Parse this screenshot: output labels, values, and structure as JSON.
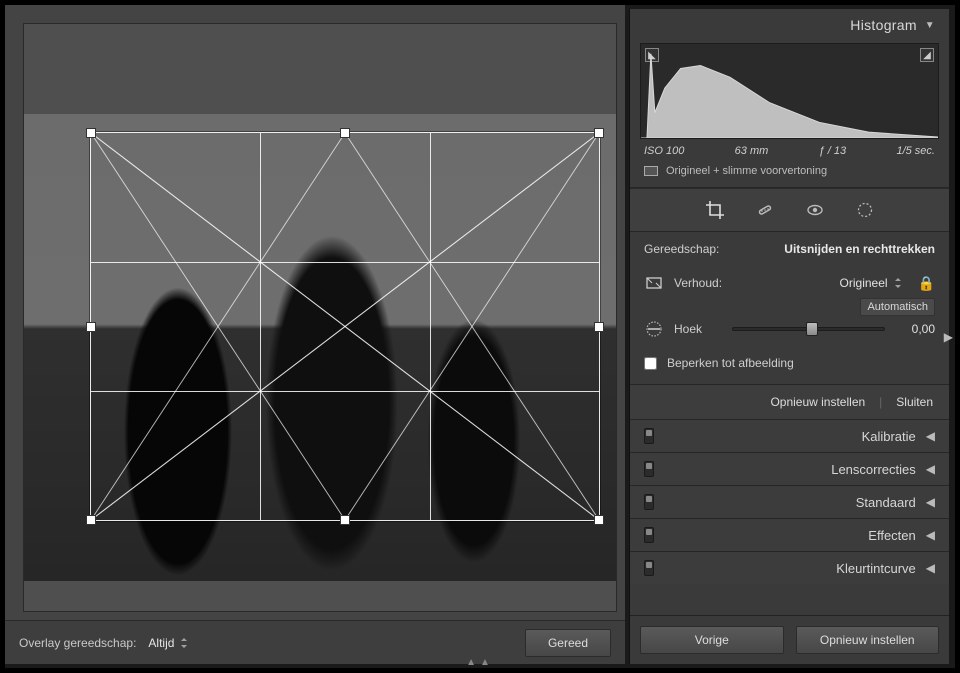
{
  "sidebar": {
    "histogram_label": "Histogram",
    "exif": {
      "iso": "ISO 100",
      "focal": "63 mm",
      "aperture": "ƒ / 13",
      "shutter": "1/5 sec."
    },
    "preview_label": "Origineel + slimme voorvertoning",
    "tool_label": "Gereedschap:",
    "tool_name": "Uitsnijden en rechttrekken",
    "aspect": {
      "label": "Verhoud:",
      "value": "Origineel"
    },
    "auto_label": "Automatisch",
    "angle": {
      "label": "Hoek",
      "value": "0,00"
    },
    "constrain_label": "Beperken tot afbeelding",
    "actions": {
      "reset": "Opnieuw instellen",
      "close": "Sluiten"
    },
    "accordions": [
      "Kalibratie",
      "Lenscorrecties",
      "Standaard",
      "Effecten",
      "Kleurtintcurve"
    ],
    "footer": {
      "prev": "Vorige",
      "reset": "Opnieuw instellen"
    }
  },
  "bottombar": {
    "overlay_label": "Overlay gereedschap:",
    "overlay_value": "Altijd",
    "done": "Gereed"
  }
}
